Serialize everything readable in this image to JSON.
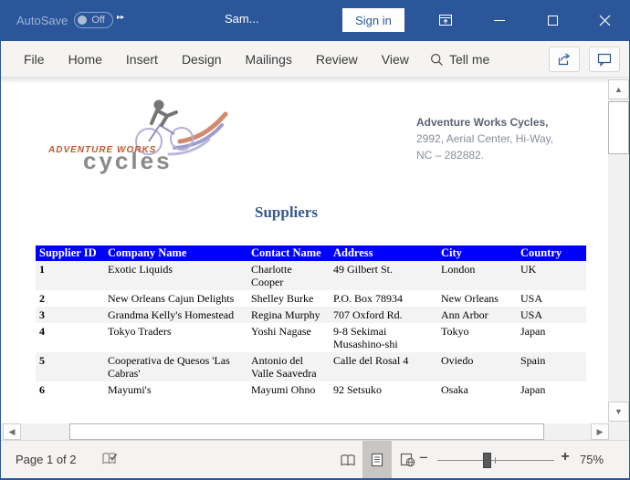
{
  "titlebar": {
    "autosave_label": "AutoSave",
    "autosave_state": "Off",
    "overflow_glyph": "▸▸",
    "title": "Sam...",
    "sign_in": "Sign in"
  },
  "ribbon": {
    "tabs": [
      "File",
      "Home",
      "Insert",
      "Design",
      "Mailings",
      "Review",
      "View"
    ],
    "tell_me": "Tell me"
  },
  "document": {
    "logo": {
      "brand_top": "ADVENTURE WORKS",
      "brand_bottom": "cycles"
    },
    "address": {
      "line1": "Adventure Works Cycles,",
      "line2": "2992, Aerial Center, Hi-Way,",
      "line3": "NC – 282882."
    },
    "heading": "Suppliers",
    "table": {
      "headers": [
        "Supplier ID",
        "Company Name",
        "Contact Name",
        "Address",
        "City",
        "Country"
      ],
      "rows": [
        [
          "1",
          "Exotic Liquids",
          "Charlotte Cooper",
          "49 Gilbert St.",
          "London",
          "UK"
        ],
        [
          "2",
          "New Orleans Cajun Delights",
          "Shelley Burke",
          "P.O. Box 78934",
          "New Orleans",
          "USA"
        ],
        [
          "3",
          "Grandma Kelly's Homestead",
          "Regina Murphy",
          "707 Oxford Rd.",
          "Ann Arbor",
          "USA"
        ],
        [
          "4",
          "Tokyo Traders",
          "Yoshi Nagase",
          "9-8 Sekimai Musashino-shi",
          "Tokyo",
          "Japan"
        ],
        [
          "5",
          "Cooperativa de Quesos 'Las Cabras'",
          "Antonio del Valle Saavedra",
          "Calle del Rosal 4",
          "Oviedo",
          "Spain"
        ],
        [
          "6",
          "Mayumi's",
          "Mayumi Ohno",
          "92 Setsuko",
          "Osaka",
          "Japan"
        ]
      ]
    }
  },
  "scrollbars": {
    "up_glyph": "▲",
    "down_glyph": "▼",
    "left_glyph": "◀",
    "right_glyph": "▶"
  },
  "statusbar": {
    "page_indicator": "Page 1 of 2",
    "zoom_out_glyph": "−",
    "zoom_in_glyph": "+",
    "zoom_level": "75%"
  },
  "colors": {
    "titlebar_blue": "#2b579a",
    "table_header_blue": "#0000fe",
    "heading_blue": "#33598e",
    "logo_orange": "#c5572e",
    "logo_gray": "#8a8a8a"
  }
}
